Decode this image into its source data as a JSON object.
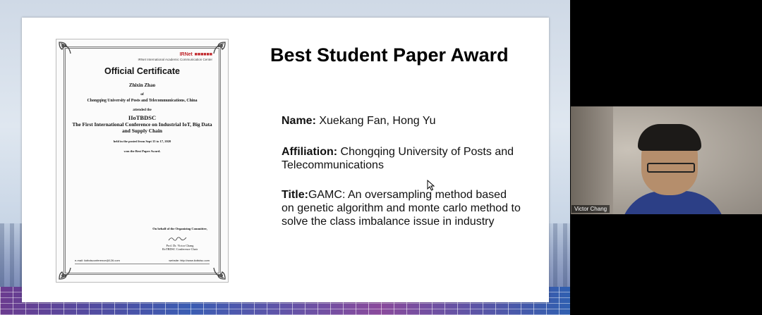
{
  "slide": {
    "title": "Best Student Paper Award",
    "name_label": "Name:",
    "name_value": " Xuekang Fan, Hong Yu",
    "affiliation_label": "Affiliation:",
    "affiliation_value": " Chongqing University of Posts and Telecommunications",
    "title_label": "Title:",
    "title_value": "GAMC: An oversampling method based on genetic algorithm and monte carlo method to solve the class imbalance issue in industry"
  },
  "certificate": {
    "logo_text": "IRNet",
    "logo_subtitle": "IRNet International Academic Communication Center",
    "heading": "Official Certificate",
    "recipient": "Zhixin Zhao",
    "of": "of",
    "university": "Chongqing University of Posts and Telecommunications, China",
    "attended": "attended the",
    "conference_short": "IIoTBDSC",
    "conference_full": "The First International Conference on Industrial IoT, Big Data and Supply Chain",
    "held": "held in the posted from Sept 15 to 17, 2020",
    "won": "won the Best Paper Award.",
    "behalf": "On behalf of the Organizing Committee,",
    "signer": "Prof. Dr. Victor Chang",
    "signer_role": "IIoTBDSC Conference Chair",
    "email": "e-mail: iiotbdsconference@126.com",
    "website": "website: http://www.iiotbdsc.com"
  },
  "video": {
    "participant_name": "Victor Chang"
  },
  "icons": {
    "cursor": "mouse-pointer-icon"
  }
}
